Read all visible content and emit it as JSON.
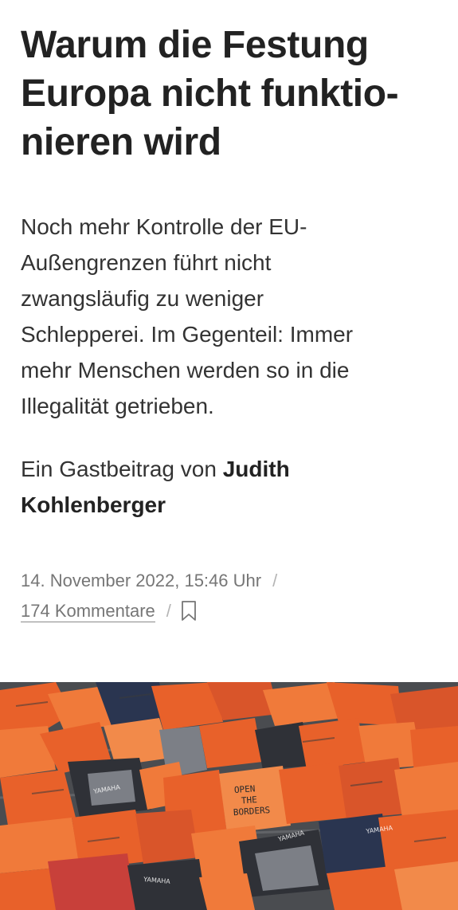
{
  "article": {
    "headline_lines": [
      "Warum die Festung",
      "Europa nicht funktio-",
      "nieren wird"
    ],
    "teaser_lines": [
      "Noch mehr Kontrolle der EU-",
      "Außengrenzen führt nicht",
      "zwangsläufig zu weniger",
      "Schlepperei. Im Gegenteil: Immer",
      "mehr Menschen werden so in die",
      "Illegalität getrieben."
    ],
    "byline": {
      "prefix": "Ein Gastbeitrag von ",
      "author_first": "Judith",
      "author_last": "Kohlenberger"
    },
    "meta": {
      "date": "14. November 2022, 15:46 Uhr",
      "separator": "/",
      "comments_label": "174 Kommentare",
      "bookmark_icon": "bookmark-icon"
    }
  },
  "hero_image": {
    "alt": "Rettungswesten",
    "colors": {
      "orange": "#e8612a",
      "orange_light": "#f07a3a",
      "dark": "#2f3137",
      "grey": "#7c7f86",
      "navy": "#2a3550"
    },
    "vest_lettering": [
      "OPEN",
      "THE",
      "BORDERS"
    ],
    "brand_lettering": "YAMAHA"
  },
  "colors": {
    "headline": "#222222",
    "body": "#333333",
    "meta": "#767676"
  }
}
